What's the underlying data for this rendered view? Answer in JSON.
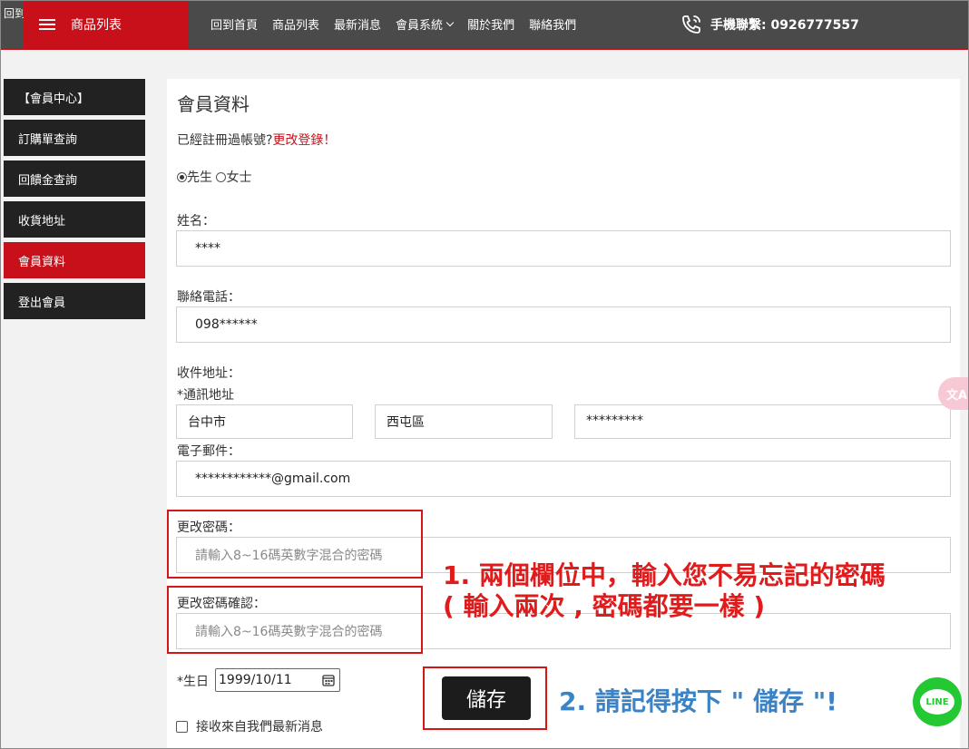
{
  "header": {
    "stray_text": "回到",
    "menu_label": "商品列表",
    "nav": [
      {
        "label": "回到首頁"
      },
      {
        "label": "商品列表"
      },
      {
        "label": "最新消息"
      },
      {
        "label": "會員系統"
      },
      {
        "label": "關於我們"
      },
      {
        "label": "聯絡我們"
      }
    ],
    "phone_text": "手機聯繫: 0926777557"
  },
  "sidebar": {
    "items": [
      {
        "label": "【會員中心】"
      },
      {
        "label": "訂購單查詢"
      },
      {
        "label": "回饋金查詢"
      },
      {
        "label": "收貨地址"
      },
      {
        "label": "會員資料"
      },
      {
        "label": "登出會員"
      }
    ]
  },
  "form": {
    "title": "會員資料",
    "registered_prompt": "已經註冊過帳號?",
    "change_login_link": "更改登錄！",
    "gender_male": "先生",
    "gender_female": "女士",
    "name_label": "姓名：",
    "name_value": "****",
    "phone_label": "聯絡電話：",
    "phone_value": "098******",
    "address_label": "收件地址：",
    "mailing_address_label": "*通訊地址",
    "city_value": "台中市",
    "district_value": "西屯區",
    "street_value": "*********",
    "email_label": "電子郵件：",
    "email_value": "************@gmail.com",
    "password_label": "更改密碼：",
    "password_placeholder": "請輸入8~16碼英數字混合的密碼",
    "password_confirm_label": "更改密碼確認：",
    "password_confirm_placeholder": "請輸入8~16碼英數字混合的密碼",
    "birthday_label": "*生日",
    "birthday_value": "1999/10/11",
    "newsletter_label": "接收來自我們最新消息",
    "save_label": "儲存"
  },
  "annotations": {
    "step1_line1": "1. 兩個欄位中，輸入您不易忘記的密碼",
    "step1_line2": "( 輸入兩次 , 密碼都要一樣 )",
    "step2": "2. 請記得按下 \" 儲存 \"!"
  },
  "widgets": {
    "translate_label": "文A",
    "line_label": "LINE"
  },
  "colors": {
    "brand_red": "#c8101a",
    "header_gray": "#4a4a4a",
    "annotation_red": "#e01b1b",
    "annotation_blue": "#3b83c4",
    "line_green": "#23c832"
  }
}
